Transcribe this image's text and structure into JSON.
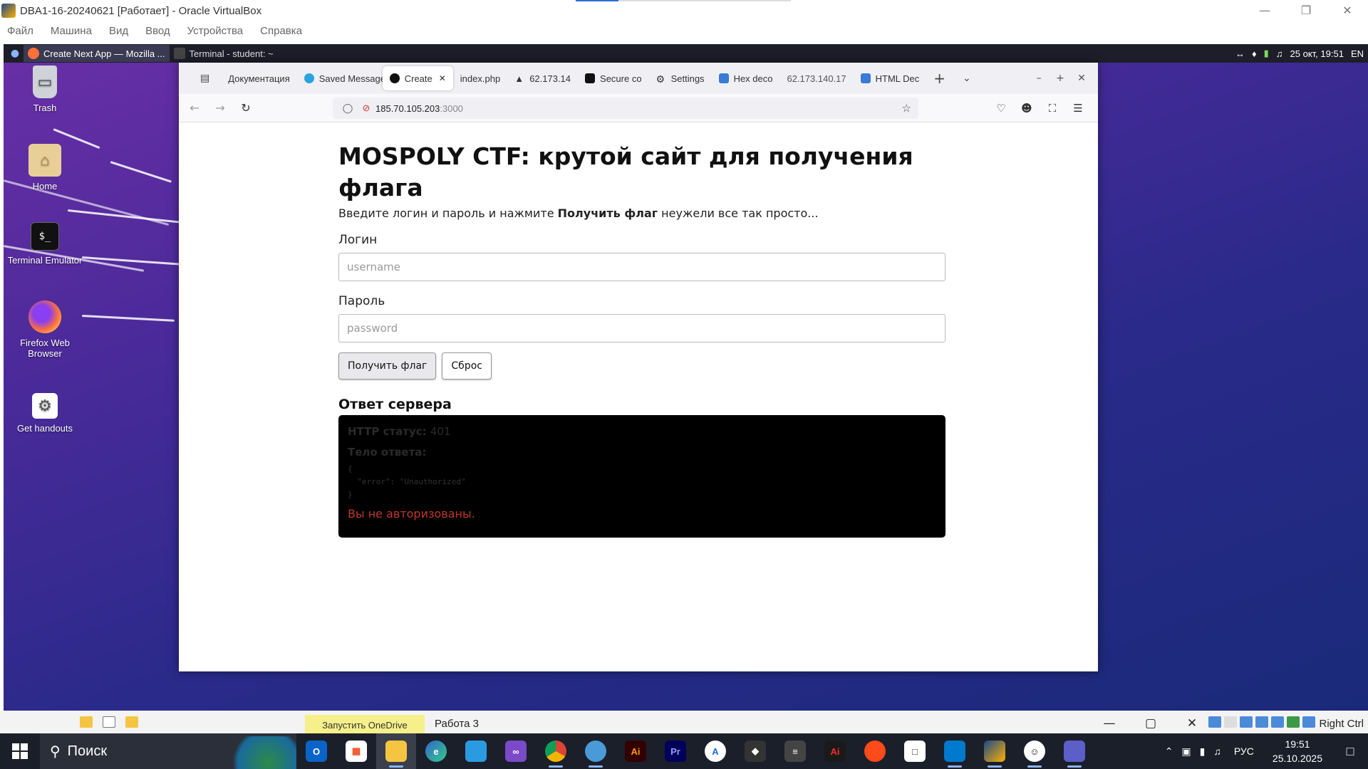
{
  "host_window": {
    "title": "DBA1-16-20240621 [Работает] - Oracle VirtualBox",
    "menu": [
      "Файл",
      "Машина",
      "Вид",
      "Ввод",
      "Устройства",
      "Справка"
    ]
  },
  "guest_panel": {
    "tasks": [
      {
        "label": "Create Next App — Mozilla ...",
        "active": true
      },
      {
        "label": "Terminal - student: ~",
        "active": false
      }
    ],
    "tray_time": "25 окт, 19:51",
    "tray_lang": "EN"
  },
  "desktop_icons": [
    {
      "label": "Trash",
      "icon": "trash-icon"
    },
    {
      "label": "Home",
      "icon": "home-folder-icon"
    },
    {
      "label": "Terminal Emulator",
      "icon": "terminal-icon"
    },
    {
      "label": "Firefox Web Browser",
      "icon": "firefox-icon"
    },
    {
      "label": "Get handouts",
      "icon": "gear-icon"
    }
  ],
  "browser": {
    "tabs": [
      {
        "label": "Документация",
        "icon": "doc-icon"
      },
      {
        "label": "Saved Messages",
        "icon": "telegram-icon"
      },
      {
        "label": "Create Next App",
        "icon": "nextjs-icon",
        "active": true
      },
      {
        "label": "index.php",
        "icon": "none"
      },
      {
        "label": "62.173.14",
        "icon": "warning-icon"
      },
      {
        "label": "Secure co",
        "icon": "terminal-icon"
      },
      {
        "label": "Settings",
        "icon": "gear-icon"
      },
      {
        "label": "Hex deco",
        "icon": "hex-icon"
      },
      {
        "label": "62.173.140.17",
        "icon": "none"
      },
      {
        "label": "HTML Dec",
        "icon": "tools-icon"
      }
    ],
    "url_host": "185.70.105.203",
    "url_port": ":3000"
  },
  "page": {
    "title": "MOSPOLY CTF: крутой сайт для получения флага",
    "lead_pre": "Введите логин и пароль и нажмите ",
    "lead_bold": "Получить флаг",
    "lead_post": " неужели все так просто...",
    "login_label": "Логин",
    "login_placeholder": "username",
    "password_label": "Пароль",
    "password_placeholder": "password",
    "submit_label": "Получить флаг",
    "reset_label": "Сброс",
    "response_heading": "Ответ сервера",
    "status_label": "HTTP статус:",
    "status_value": "401",
    "body_label": "Тело ответа:",
    "body_json": "{\n  \"error\": \"Unauthorized\"\n}",
    "error_message": "Вы не авторизованы."
  },
  "host_strip": {
    "onedrive": "Запустить OneDrive",
    "window_title": "Работа 3",
    "right_ctrl": "Right Ctrl"
  },
  "taskbar": {
    "search_placeholder": "Поиск",
    "lang": "РУС",
    "time": "19:51",
    "date": "25.10.2025"
  }
}
